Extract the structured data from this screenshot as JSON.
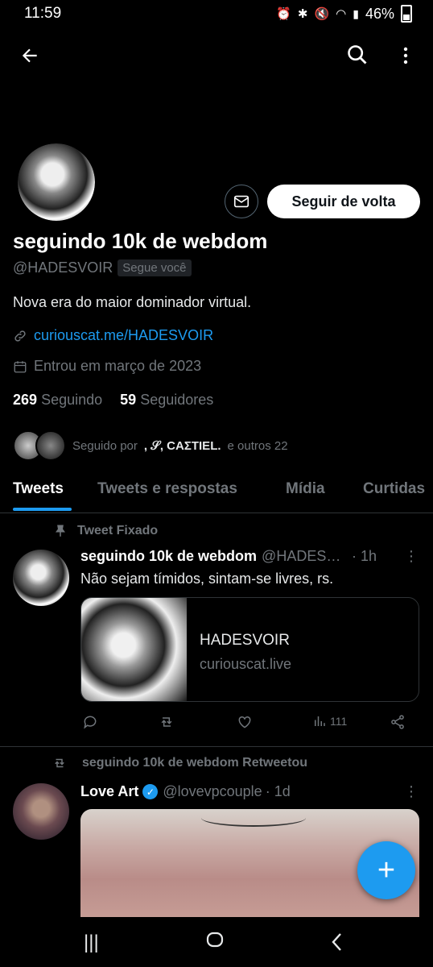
{
  "status_bar": {
    "time": "11:59",
    "battery": "46%"
  },
  "profile": {
    "display_name": "seguindo 10k de webdom",
    "handle": "@HADESVOIR",
    "follows_you": "Segue você",
    "bio": "Nova era do maior dominador virtual.",
    "link": "curiouscat.me/HADESVOIR",
    "joined": "Entrou em março de 2023",
    "following_count": "269",
    "following_label": "Seguindo",
    "followers_count": "59",
    "followers_label": "Seguidores",
    "followed_by_prefix": "Seguido por",
    "followed_by_names": ", 𝒮, CAΣTIEL.",
    "followed_by_suffix": "e outros 22",
    "follow_back_label": "Seguir de volta"
  },
  "tabs": [
    {
      "label": "Tweets",
      "active": true
    },
    {
      "label": "Tweets e respostas",
      "active": false
    },
    {
      "label": "Mídia",
      "active": false
    },
    {
      "label": "Curtidas",
      "active": false
    }
  ],
  "pinned_tweet": {
    "pinned_label": "Tweet Fixado",
    "name": "seguindo 10k de webdom",
    "handle": "@HADESVOIR",
    "time": "· 1h",
    "text": "Não sejam tímidos, sintam-se livres, rs.",
    "card_title": "HADESVOIR",
    "card_domain": "curiouscat.live",
    "views": "111"
  },
  "retweet": {
    "retweet_label": "seguindo 10k de webdom Retweetou",
    "name": "Love Art",
    "handle": "@lovevpcouple",
    "time": "· 1d"
  },
  "colors": {
    "accent": "#1d9bf0",
    "background": "#000000",
    "secondary_text": "#71767b",
    "divider": "#2f3336"
  },
  "icons": [
    "back-arrow-icon",
    "search-icon",
    "more-vertical-icon",
    "mail-icon",
    "link-icon",
    "calendar-icon",
    "pin-icon",
    "reply-icon",
    "retweet-icon",
    "like-icon",
    "views-icon",
    "share-icon",
    "verified-icon",
    "compose-plus-icon",
    "recent-apps-icon",
    "home-icon",
    "back-nav-icon"
  ]
}
